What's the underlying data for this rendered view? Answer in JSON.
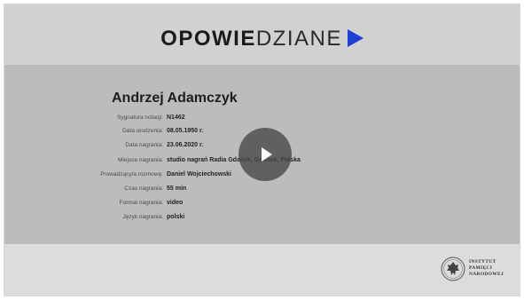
{
  "logo": {
    "bold_part": "OPOWIE",
    "light_part": "DZIANE",
    "arrow_icon": "play-triangle-icon",
    "arrow_color": "#1f3fd6"
  },
  "person": {
    "name": "Andrzej Adamczyk"
  },
  "details": [
    {
      "label": "Sygnatura notacji:",
      "value": "N1462"
    },
    {
      "label": "Data urodzenia:",
      "value": "08.05.1950 r."
    },
    {
      "label": "Data nagrania:",
      "value": "23.06.2020 r."
    },
    {
      "label": "Miejsce nagrania:",
      "value": "studio nagrań Radia Gdańsk, Gdańsk, Polska"
    },
    {
      "label": "Prowadzący/a rozmowę:",
      "value": "Daniel Wojciechowski"
    },
    {
      "label": "Czas nagrania:",
      "value": "55 min"
    },
    {
      "label": "Format nagrania:",
      "value": "video"
    },
    {
      "label": "Język nagrania:",
      "value": "polski"
    }
  ],
  "player": {
    "play_icon": "play-icon"
  },
  "institution": {
    "logo_icon": "ipn-seal-icon",
    "line1": "INSTYTUT",
    "line2": "PAMIĘCI",
    "line3": "NARODOWEJ"
  }
}
